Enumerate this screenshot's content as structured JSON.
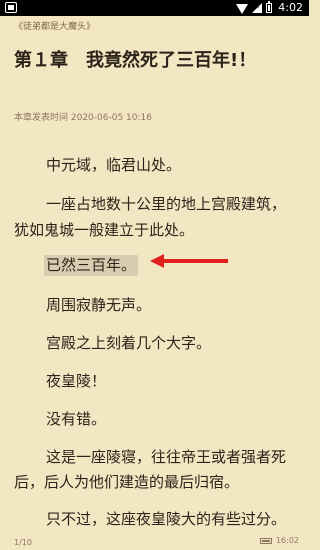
{
  "status_bar": {
    "time": "4:02",
    "battery_level": 0.6,
    "icons": [
      "app-icon",
      "wifi-icon",
      "signal-icon",
      "battery-icon"
    ]
  },
  "book": {
    "title": "《徒弟都是大魔头》"
  },
  "chapter": {
    "title": "第１章　我竟然死了三百年!！",
    "publish_time": "本章发表时间 2020-06-05 10:16"
  },
  "content": {
    "paragraphs": [
      "中元域，临君山处。",
      "一座占地数十公里的地上宫殿建筑，",
      "犹如鬼城一般建立于此处。",
      "已然三百年。",
      "周围寂静无声。",
      "宫殿之上刻着几个大字。",
      "夜皇陵！",
      "没有错。",
      "这是一座陵寝，往往帝王或者强者死",
      "后，后人为他们建造的最后归宿。",
      "只不过，这座夜皇陵大的有些过分。"
    ],
    "highlight_index": 3
  },
  "footer": {
    "page": "1/10",
    "time": "16:02",
    "battery_level": 0.7
  },
  "colors": {
    "background": "#f3e6c3",
    "text": "#2c241a",
    "arrow": "#e0221e",
    "highlight": "#d8cdb1"
  }
}
